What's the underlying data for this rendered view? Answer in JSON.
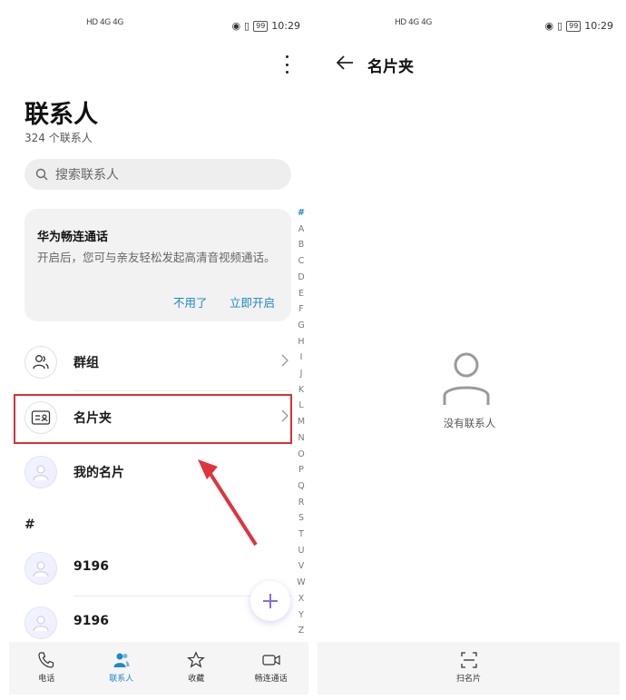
{
  "status_bar": {
    "carrier_text": "HD 4G 4G",
    "battery": "99",
    "time": "10:29"
  },
  "contacts_screen": {
    "title": "联系人",
    "count_text": "324 个联系人",
    "search_placeholder": "搜索联系人",
    "promo": {
      "title": "华为畅连通话",
      "description": "开启后，您可与亲友轻松发起高清音视频通话。",
      "dismiss_label": "不用了",
      "enable_label": "立即开启"
    },
    "rows": [
      {
        "label": "群组"
      },
      {
        "label": "名片夹"
      },
      {
        "label": "我的名片"
      }
    ],
    "section_header": "#",
    "contacts": [
      {
        "name": "9196"
      },
      {
        "name": "9196"
      }
    ],
    "alphabet_index": [
      "#",
      "A",
      "B",
      "C",
      "D",
      "E",
      "F",
      "G",
      "H",
      "I",
      "J",
      "K",
      "L",
      "M",
      "N",
      "O",
      "P",
      "Q",
      "R",
      "S",
      "T",
      "U",
      "V",
      "W",
      "X",
      "Y",
      "Z"
    ],
    "tabs": [
      {
        "label": "电话",
        "icon": "phone-icon",
        "active": false
      },
      {
        "label": "联系人",
        "icon": "contacts-icon",
        "active": true
      },
      {
        "label": "收藏",
        "icon": "star-icon",
        "active": false
      },
      {
        "label": "畅连通话",
        "icon": "video-call-icon",
        "active": false
      }
    ]
  },
  "card_folder_screen": {
    "title": "名片夹",
    "empty_text": "没有联系人",
    "scan_label": "扫名片"
  },
  "colors": {
    "accent": "#1e88c9",
    "highlight_border": "#d8303a",
    "annotation_arrow": "#e0343d"
  }
}
